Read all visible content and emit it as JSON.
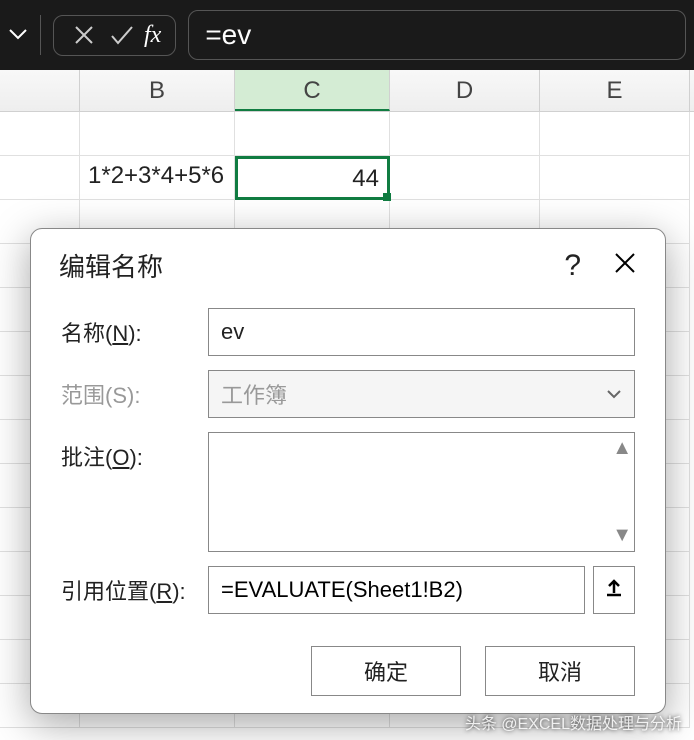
{
  "formula_bar": {
    "fx_label": "fx",
    "formula": "=ev"
  },
  "columns": [
    "",
    "B",
    "C",
    "D",
    "E"
  ],
  "grid": {
    "b2": "1*2+3*4+5*6",
    "c2": "44"
  },
  "dialog": {
    "title": "编辑名称",
    "help": "?",
    "labels": {
      "name": "名称(",
      "name_u": "N",
      "name_end": "):",
      "scope": "范围(S):",
      "comment": "批注(",
      "comment_u": "O",
      "comment_end": "):",
      "refers": "引用位置(",
      "refers_u": "R",
      "refers_end": "):"
    },
    "fields": {
      "name": "ev",
      "scope": "工作簿",
      "comment": "",
      "refers": "=EVALUATE(Sheet1!B2)"
    },
    "buttons": {
      "ok": "确定",
      "cancel": "取消"
    }
  },
  "watermark": "头条 @EXCEL数据处理与分析"
}
